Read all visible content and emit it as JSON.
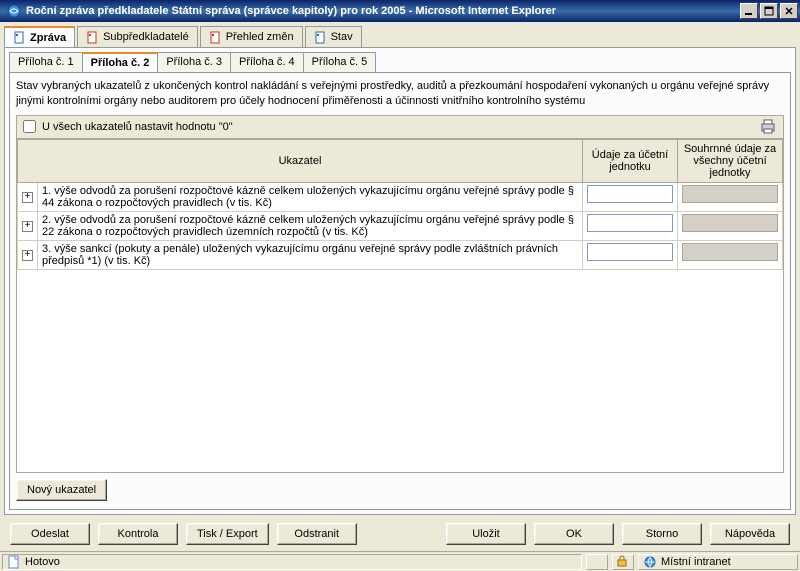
{
  "window": {
    "title": "Roční zpráva předkladatele Státní správa (správce kapitoly) pro rok 2005 - Microsoft Internet Explorer"
  },
  "main_tabs": [
    {
      "label": "Zpráva",
      "icon": "document-icon",
      "icon_color": "#2a6ac1"
    },
    {
      "label": "Subpředkladatelé",
      "icon": "users-icon",
      "icon_color": "#c13a2a"
    },
    {
      "label": "Přehled změn",
      "icon": "edit-icon",
      "icon_color": "#c13a2a"
    },
    {
      "label": "Stav",
      "icon": "person-icon",
      "icon_color": "#2a6ac1"
    }
  ],
  "active_main_tab": 0,
  "sub_tabs": [
    {
      "label": "Příloha č. 1"
    },
    {
      "label": "Příloha č. 2"
    },
    {
      "label": "Příloha č. 3"
    },
    {
      "label": "Příloha č. 4"
    },
    {
      "label": "Příloha č. 5"
    }
  ],
  "active_sub_tab": 1,
  "description": "Stav vybraných ukazatelů z ukončených kontrol nakládání s veřejnými prostředky, auditů a přezkoumání hospodaření vykonaných u orgánu veřejné správy jinými kontrolními orgány nebo auditorem pro účely hodnocení přiměřenosti a účinnosti vnitřního kontrolního systému",
  "checkbox_label": "U všech ukazatelů nastavit hodnotu \"0\"",
  "columns": {
    "c1": "Ukazatel",
    "c2": "Údaje za účetní jednotku",
    "c3": "Souhrnné údaje za všechny účetní jednotky"
  },
  "rows": [
    {
      "text": "1. výše odvodů za porušení rozpočtové kázně celkem uložených vykazujícímu orgánu veřejné správy podle § 44 zákona o rozpočtových pravidlech (v tis. Kč)",
      "v1": "",
      "v2": ""
    },
    {
      "text": "2. výše odvodů za porušení rozpočtové kázně celkem uložených vykazujícímu orgánu veřejné správy podle § 22 zákona o rozpočtových pravidlech územních rozpočtů  (v tis. Kč)",
      "v1": "",
      "v2": ""
    },
    {
      "text": "3. výše sankcí (pokuty a penále) uložených vykazujícímu orgánu veřejné správy podle zvláštních právních předpisů *1) (v tis. Kč)",
      "v1": "",
      "v2": ""
    }
  ],
  "buttons": {
    "new": "Nový ukazatel",
    "send": "Odeslat",
    "check": "Kontrola",
    "print": "Tisk / Export",
    "delete": "Odstranit",
    "save": "Uložit",
    "ok": "OK",
    "cancel": "Storno",
    "help": "Nápověda"
  },
  "status": {
    "text": "Hotovo",
    "zone": "Místní intranet"
  }
}
